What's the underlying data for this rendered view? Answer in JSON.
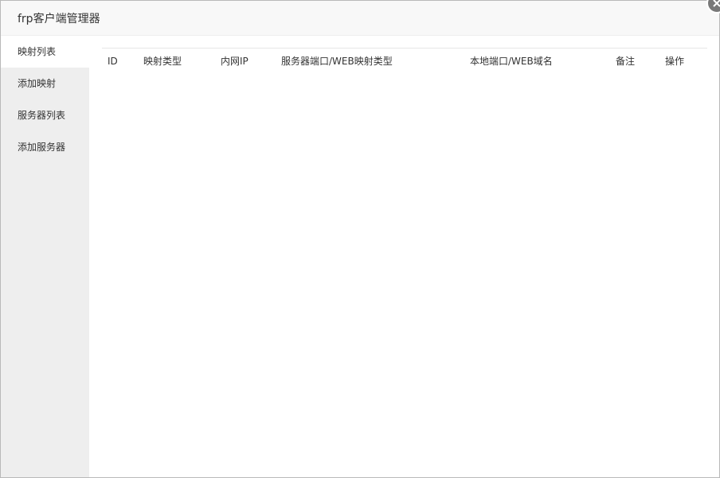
{
  "window": {
    "title": "frp客户端管理器"
  },
  "sidebar": {
    "items": [
      {
        "label": "映射列表",
        "active": true
      },
      {
        "label": "添加映射",
        "active": false
      },
      {
        "label": "服务器列表",
        "active": false
      },
      {
        "label": "添加服务器",
        "active": false
      }
    ]
  },
  "table": {
    "headers": [
      "ID",
      "映射类型",
      "内网IP",
      "服务器端口/WEB映射类型",
      "本地端口/WEB域名",
      "备注",
      "操作"
    ],
    "rows": []
  },
  "icons": {
    "close": "close-icon"
  },
  "colors": {
    "sidebar_bg": "#eeeeee",
    "titlebar_bg": "#f8f8f8",
    "close_bg": "#787878"
  }
}
